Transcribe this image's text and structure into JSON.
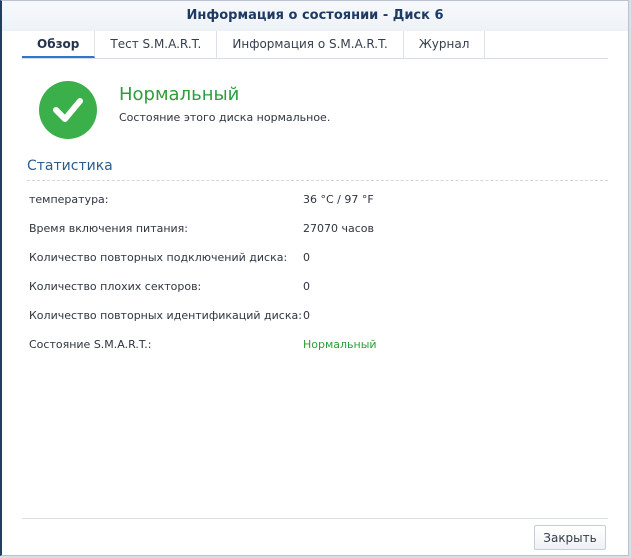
{
  "window": {
    "title": "Информация о состоянии - Диск 6"
  },
  "tabs": [
    {
      "label": "Обзор",
      "active": true
    },
    {
      "label": "Тест S.M.A.R.T.",
      "active": false
    },
    {
      "label": "Информация о S.M.A.R.T.",
      "active": false
    },
    {
      "label": "Журнал",
      "active": false
    }
  ],
  "status": {
    "icon": "check-circle-icon",
    "title": "Нормальный",
    "description": "Состояние этого диска нормальное.",
    "color": "#3bb04a"
  },
  "statistics": {
    "title": "Статистика",
    "rows": [
      {
        "label": "температура:",
        "value": "36 °C / 97 °F"
      },
      {
        "label": "Время включения питания:",
        "value": "27070 часов"
      },
      {
        "label": "Количество повторных подключений диска:",
        "value": "0"
      },
      {
        "label": "Количество плохих секторов:",
        "value": "0"
      },
      {
        "label": "Количество повторных идентификаций диска:",
        "value": "0"
      },
      {
        "label": "Состояние S.M.A.R.T.:",
        "value": "Нормальный"
      }
    ]
  },
  "footer": {
    "close_label": "Закрыть"
  }
}
